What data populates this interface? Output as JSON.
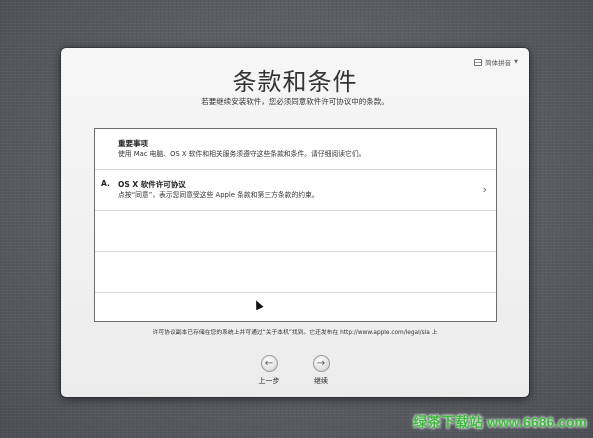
{
  "language_menu": {
    "label": "简体拼音",
    "icon": "keyboard-flag-icon"
  },
  "title": "条款和条件",
  "subtitle": "若要继续安装软件，您必须同意软件许可协议中的条款。",
  "items": [
    {
      "marker": "",
      "heading": "重要事项",
      "description": "使用 Mac 电脑、OS X 软件和相关服务须遵守这些条款和条件。请仔细阅读它们。",
      "has_chevron": false
    },
    {
      "marker": "A.",
      "heading": "OS X 软件许可协议",
      "description": "点按“同意”，表示您同意受这些 Apple 条款和第三方条款的约束。",
      "has_chevron": true
    }
  ],
  "footnote": "许可协议副本已存储在您的系统上并可通过“关于本机”找到。它还发布在 http://www.apple.com/legal/sla 上",
  "nav": {
    "back_label": "上一步",
    "continue_label": "继续"
  },
  "watermark": "绿茶下载站 www.6686.com"
}
